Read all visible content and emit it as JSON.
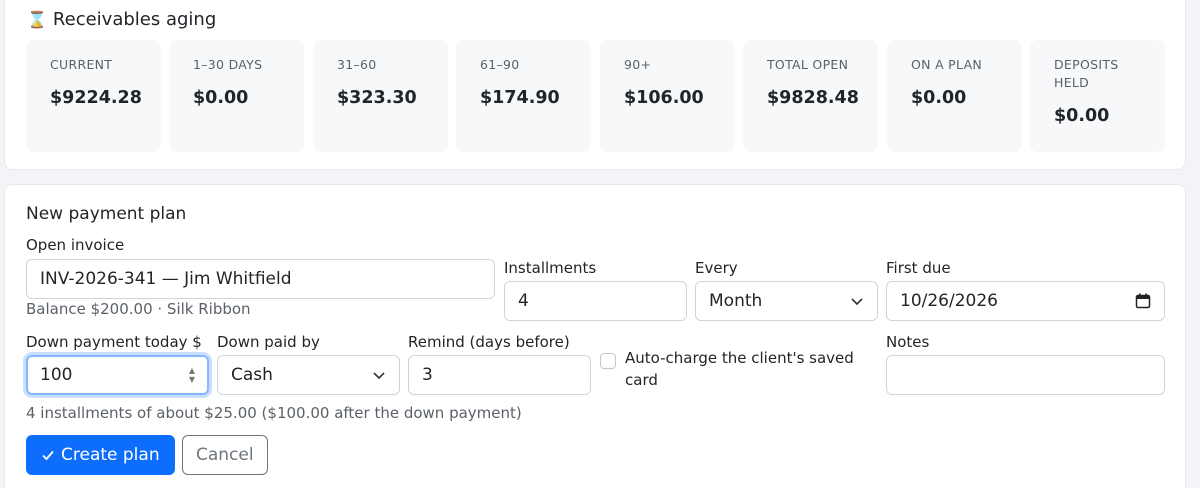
{
  "aging": {
    "title": "Receivables aging",
    "icon": "hourglass-icon",
    "tiles": [
      {
        "label": "CURRENT",
        "value": "$9224.28"
      },
      {
        "label": "1–30 DAYS",
        "value": "$0.00"
      },
      {
        "label": "31–60",
        "value": "$323.30"
      },
      {
        "label": "61–90",
        "value": "$174.90"
      },
      {
        "label": "90+",
        "value": "$106.00"
      },
      {
        "label": "TOTAL OPEN",
        "value": "$9828.48"
      },
      {
        "label": "ON A PLAN",
        "value": "$0.00"
      },
      {
        "label": "DEPOSITS HELD",
        "value": "$0.00"
      }
    ]
  },
  "plan": {
    "title": "New payment plan",
    "invoice": {
      "label": "Open invoice",
      "value": "INV-2026-341 — Jim Whitfield",
      "hint": "Balance $200.00 · Silk Ribbon"
    },
    "installments": {
      "label": "Installments",
      "value": "4"
    },
    "every": {
      "label": "Every",
      "value": "Month"
    },
    "first_due": {
      "label": "First due",
      "value": "10/26/2026"
    },
    "down_payment": {
      "label": "Down payment today $",
      "value": "100"
    },
    "down_paid_by": {
      "label": "Down paid by",
      "value": "Cash"
    },
    "remind": {
      "label": "Remind (days before)",
      "value": "3"
    },
    "autocharge": {
      "label": "Auto-charge the client's saved card",
      "checked": false
    },
    "notes": {
      "label": "Notes",
      "value": ""
    },
    "summary": "4 installments of about $25.00 ($100.00 after the down payment)",
    "create_label": "Create plan",
    "cancel_label": "Cancel"
  },
  "colors": {
    "primary": "#0d6efd",
    "tile_bg": "#f7f8fa",
    "focus_ring": "#86b7fe"
  }
}
